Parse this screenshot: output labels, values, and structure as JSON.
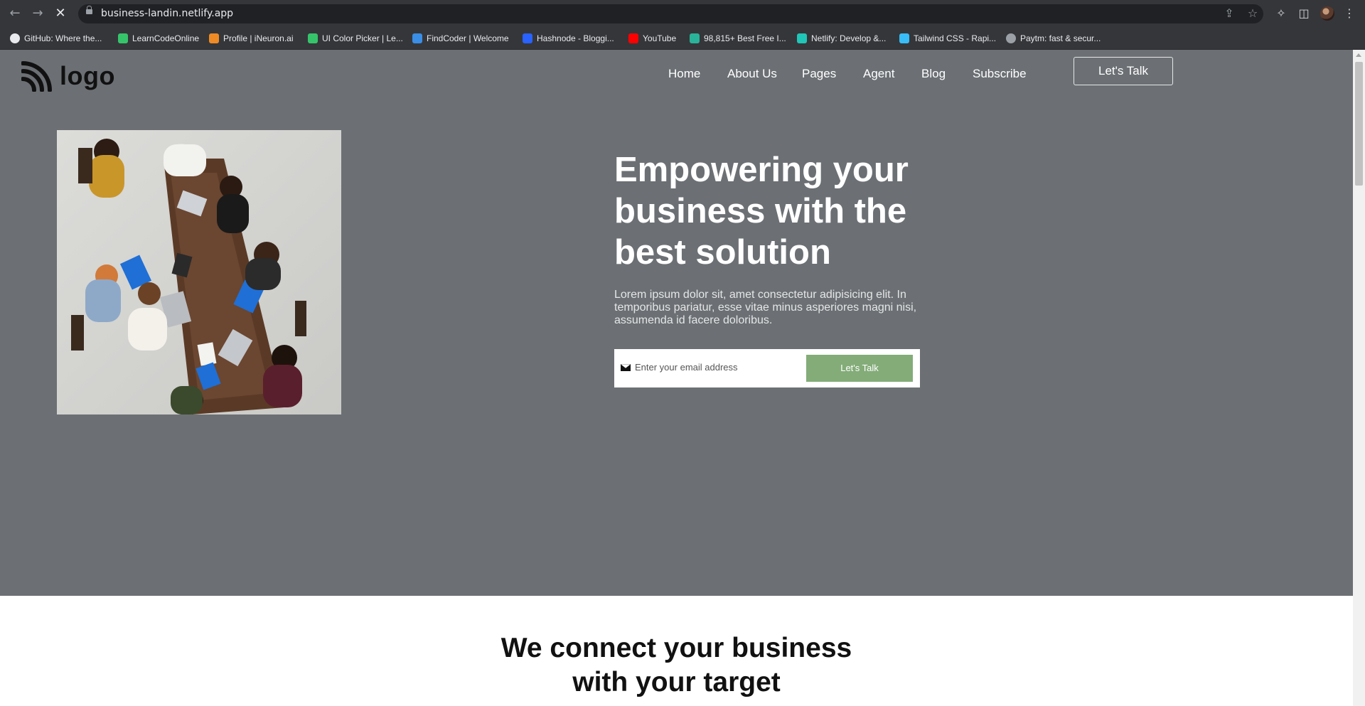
{
  "browser": {
    "url": "business-landin.netlify.app",
    "bookmarks": [
      {
        "label": "GitHub: Where the...",
        "icon": "github-icon",
        "color": "#ffffff"
      },
      {
        "label": "LearnCodeOnline",
        "icon": "learncodeonline-icon",
        "color": "#36c46b"
      },
      {
        "label": "Profile | iNeuron.ai",
        "icon": "ineuron-icon",
        "color": "#f08a24"
      },
      {
        "label": "UI Color Picker | Le...",
        "icon": "learncodeonline-icon",
        "color": "#36c46b"
      },
      {
        "label": "FindCoder | Welcome",
        "icon": "code-icon",
        "color": "#3a8ee6"
      },
      {
        "label": "Hashnode - Bloggi...",
        "icon": "hashnode-icon",
        "color": "#2962ff"
      },
      {
        "label": "YouTube",
        "icon": "youtube-icon",
        "color": "#ff0000"
      },
      {
        "label": "98,815+ Best Free I...",
        "icon": "freepik-icon",
        "color": "#29b39a"
      },
      {
        "label": "Netlify: Develop &...",
        "icon": "netlify-icon",
        "color": "#20c6b7"
      },
      {
        "label": "Tailwind CSS - Rapi...",
        "icon": "tailwind-icon",
        "color": "#38bdf8"
      },
      {
        "label": "Paytm: fast & secur...",
        "icon": "globe-icon",
        "color": "#9aa0a6"
      }
    ]
  },
  "header": {
    "logo_text": "logo",
    "nav": [
      "Home",
      "About Us",
      "Pages",
      "Agent",
      "Blog",
      "Subscribe"
    ],
    "cta_label": "Let's Talk"
  },
  "hero": {
    "title": "Empowering your business with the best solution",
    "subtitle": "Lorem ipsum dolor sit, amet consectetur adipisicing elit. In temporibus pariatur, esse vitae minus asperiores magni nisi, assumenda id facere doloribus.",
    "email_placeholder": "Enter your email address",
    "email_button": "Let's Talk"
  },
  "section2": {
    "title_line1": "We connect your business",
    "title_line2": "with your target"
  },
  "colors": {
    "hero_bg": "#6c7074",
    "accent_green": "#83ac78",
    "section_bg": "#ffffff"
  }
}
